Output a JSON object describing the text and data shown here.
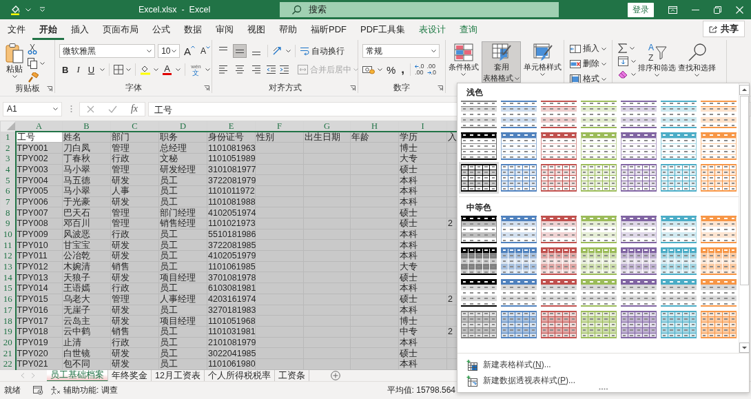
{
  "title_bar": {
    "title": "Excel.xlsx  -  Excel",
    "search_placeholder": "搜索",
    "sign_in": "登录"
  },
  "tabs": [
    {
      "label": "文件",
      "kind": "normal",
      "selected": false
    },
    {
      "label": "开始",
      "kind": "normal",
      "selected": true
    },
    {
      "label": "插入",
      "kind": "normal",
      "selected": false
    },
    {
      "label": "页面布局",
      "kind": "normal",
      "selected": false
    },
    {
      "label": "公式",
      "kind": "normal",
      "selected": false
    },
    {
      "label": "数据",
      "kind": "normal",
      "selected": false
    },
    {
      "label": "审阅",
      "kind": "normal",
      "selected": false
    },
    {
      "label": "视图",
      "kind": "normal",
      "selected": false
    },
    {
      "label": "帮助",
      "kind": "normal",
      "selected": false
    },
    {
      "label": "福昕PDF",
      "kind": "normal",
      "selected": false
    },
    {
      "label": "PDF工具集",
      "kind": "normal",
      "selected": false
    },
    {
      "label": "表设计",
      "kind": "contextual",
      "selected": false
    },
    {
      "label": "查询",
      "kind": "contextual",
      "selected": false
    }
  ],
  "share": "共享",
  "ribbon": {
    "clipboard": {
      "label": "剪贴板",
      "paste": "粘贴"
    },
    "font": {
      "label": "字体",
      "font_name": "微软雅黑",
      "font_size": "10",
      "grow": "A",
      "shrink": "A",
      "bold": "B",
      "italic": "I",
      "underline": "U",
      "font_color": "A",
      "phonetic": "wén",
      "phonetic_char": "文"
    },
    "alignment": {
      "label": "对齐方式",
      "vertical": [
        {
          "kind": "top",
          "selected": false
        },
        {
          "kind": "middle",
          "selected": true
        },
        {
          "kind": "bottom",
          "selected": false
        }
      ],
      "horizontal": [
        {
          "kind": "left",
          "selected": false
        },
        {
          "kind": "center",
          "selected": false
        },
        {
          "kind": "right",
          "selected": false
        }
      ],
      "wrap_text": "自动换行",
      "merge": {
        "label": "合并后居中",
        "disabled": true
      }
    },
    "number": {
      "label": "数字",
      "format": "常规",
      "percent": "%",
      "comma": ",",
      "increase_decimal": [
        ".0",
        ".00"
      ],
      "decrease_decimal": [
        ".00",
        ".0"
      ]
    },
    "styles": [
      {
        "kind": "conditional",
        "lines": [
          "条件格式"
        ],
        "selected": false
      },
      {
        "kind": "table",
        "lines": [
          "套用",
          "表格格式"
        ],
        "selected": true
      },
      {
        "kind": "cell",
        "lines": [
          "单元格样式"
        ],
        "selected": false
      }
    ],
    "cells": [
      {
        "kind": "insert",
        "label": "插入"
      },
      {
        "kind": "delete",
        "label": "删除"
      },
      {
        "kind": "format",
        "label": "格式"
      }
    ],
    "editing": [
      {
        "kind": "sort",
        "label": "排序和筛选",
        "icon_text": [
          "A",
          "Z"
        ]
      },
      {
        "kind": "find",
        "label": "查找和选择"
      }
    ]
  },
  "formula_bar": {
    "name_box": "A1",
    "fx": "fx",
    "value": "工号"
  },
  "sheet": {
    "columns": [
      {
        "label": "A",
        "selected": true
      },
      {
        "label": "B",
        "selected": true
      },
      {
        "label": "C",
        "selected": true
      },
      {
        "label": "D",
        "selected": true
      },
      {
        "label": "E",
        "selected": true
      },
      {
        "label": "F",
        "selected": true
      },
      {
        "label": "G",
        "selected": true
      },
      {
        "label": "H",
        "selected": true
      },
      {
        "label": "I",
        "selected": true
      },
      {
        "selected": true
      }
    ],
    "rows": [
      {
        "number": "1",
        "selected": true,
        "cells": [
          {
            "text": "工号",
            "active": true
          },
          "姓名",
          "部门",
          "职务",
          "身份证号",
          "性别",
          "出生日期",
          "年龄",
          "学历",
          "入"
        ]
      },
      {
        "number": "2",
        "selected": true,
        "cells": [
          "TPY001",
          "刀白凤",
          "管理",
          "总经理",
          "1101081963",
          null,
          null,
          null,
          "博士",
          null
        ]
      },
      {
        "number": "3",
        "selected": true,
        "cells": [
          "TPY002",
          "丁春秋",
          "行政",
          "文秘",
          "1101051989",
          null,
          null,
          null,
          "大专",
          null
        ]
      },
      {
        "number": "4",
        "selected": true,
        "cells": [
          "TPY003",
          "马小翠",
          "管理",
          "研发经理",
          "3101081977",
          null,
          null,
          null,
          "硕士",
          null
        ]
      },
      {
        "number": "5",
        "selected": true,
        "cells": [
          "TPY004",
          "马五德",
          "研发",
          "员工",
          "3722081979",
          null,
          null,
          null,
          "本科",
          null
        ]
      },
      {
        "number": "6",
        "selected": true,
        "cells": [
          "TPY005",
          "马小翠",
          "人事",
          "员工",
          "1101011972",
          null,
          null,
          null,
          "本科",
          null
        ]
      },
      {
        "number": "7",
        "selected": true,
        "cells": [
          "TPY006",
          "于光豪",
          "研发",
          "员工",
          "1101081988",
          null,
          null,
          null,
          "本科",
          null
        ]
      },
      {
        "number": "8",
        "selected": true,
        "cells": [
          "TPY007",
          "巴天石",
          "管理",
          "部门经理",
          "4102051974",
          null,
          null,
          null,
          "硕士",
          null
        ]
      },
      {
        "number": "9",
        "selected": true,
        "cells": [
          "TPY008",
          "邓百川",
          "管理",
          "销售经理",
          "1101021973",
          null,
          null,
          null,
          "硕士",
          "2"
        ]
      },
      {
        "number": "10",
        "selected": true,
        "cells": [
          "TPY009",
          "风波恶",
          "行政",
          "员工",
          "5510181986",
          null,
          null,
          null,
          "本科",
          null
        ]
      },
      {
        "number": "11",
        "selected": true,
        "cells": [
          "TPY010",
          "甘宝宝",
          "研发",
          "员工",
          "3722081985",
          null,
          null,
          null,
          "本科",
          null
        ]
      },
      {
        "number": "12",
        "selected": true,
        "cells": [
          "TPY011",
          "公冶乾",
          "研发",
          "员工",
          "4102051979",
          null,
          null,
          null,
          "本科",
          null
        ]
      },
      {
        "number": "13",
        "selected": true,
        "cells": [
          "TPY012",
          "木婉清",
          "销售",
          "员工",
          "1101061985",
          null,
          null,
          null,
          "大专",
          null
        ]
      },
      {
        "number": "14",
        "selected": true,
        "cells": [
          "TPY013",
          "天狼子",
          "研发",
          "项目经理",
          "3701081978",
          null,
          null,
          null,
          "硕士",
          null
        ]
      },
      {
        "number": "15",
        "selected": true,
        "cells": [
          "TPY014",
          "王语嫣",
          "行政",
          "员工",
          "6103081981",
          null,
          null,
          null,
          "本科",
          null
        ]
      },
      {
        "number": "16",
        "selected": true,
        "cells": [
          "TPY015",
          "乌老大",
          "管理",
          "人事经理",
          "4203161974",
          null,
          null,
          null,
          "硕士",
          "2"
        ]
      },
      {
        "number": "17",
        "selected": true,
        "cells": [
          "TPY016",
          "无崖子",
          "研发",
          "员工",
          "3270181983",
          null,
          null,
          null,
          "本科",
          null
        ]
      },
      {
        "number": "18",
        "selected": true,
        "cells": [
          "TPY017",
          "云岛主",
          "研发",
          "项目经理",
          "1101051968",
          null,
          null,
          null,
          "博士",
          null
        ]
      },
      {
        "number": "19",
        "selected": true,
        "cells": [
          "TPY018",
          "云中鹤",
          "销售",
          "员工",
          "1101031981",
          null,
          null,
          null,
          "中专",
          "2"
        ]
      },
      {
        "number": "20",
        "selected": true,
        "cells": [
          "TPY019",
          "止清",
          "行政",
          "员工",
          "2101081979",
          null,
          null,
          null,
          "本科",
          null
        ]
      },
      {
        "number": "21",
        "selected": true,
        "cells": [
          "TPY020",
          "白世镜",
          "研发",
          "员工",
          "3022041985",
          null,
          null,
          null,
          "硕士",
          null
        ]
      },
      {
        "number": "22",
        "selected": true,
        "cells": [
          "TPY021",
          "包不同",
          "研发",
          "员工",
          "1101061980",
          null,
          null,
          null,
          "本科",
          null
        ]
      }
    ]
  },
  "sheet_tabs": [
    {
      "label": "员工基础档案",
      "selected": true
    },
    {
      "label": "年终奖金",
      "selected": false
    },
    {
      "label": "12月工资表",
      "selected": false
    },
    {
      "label": "个人所得税税率",
      "selected": false
    },
    {
      "label": "工资条",
      "selected": false
    }
  ],
  "status_bar": {
    "ready": "就绪",
    "accessibility": "辅助功能: 调查",
    "average": "平均值: 15798.564"
  },
  "table_styles_menu": {
    "sections": [
      {
        "title": "浅色",
        "rows": [
          {
            "kind": "light-banded",
            "styles": [
              {
                "color": "#808080",
                "selected": false
              },
              {
                "color": "#4f81bd",
                "selected": false
              },
              {
                "color": "#c0504d",
                "selected": false
              },
              {
                "color": "#9bbb59",
                "selected": false
              },
              {
                "color": "#8064a2",
                "selected": false
              },
              {
                "color": "#4bacc6",
                "selected": false
              },
              {
                "color": "#f79646",
                "selected": false
              }
            ]
          },
          {
            "kind": "light-header",
            "styles": [
              {
                "color": "#000000",
                "selected": false
              },
              {
                "color": "#4f81bd",
                "selected": false
              },
              {
                "color": "#c0504d",
                "selected": false
              },
              {
                "color": "#9bbb59",
                "selected": false
              },
              {
                "color": "#8064a2",
                "selected": false
              },
              {
                "color": "#4bacc6",
                "selected": false
              },
              {
                "color": "#f79646",
                "selected": false
              }
            ]
          },
          {
            "kind": "light-grid",
            "styles": [
              {
                "color": "#000000",
                "selected": true
              },
              {
                "color": "#4f81bd",
                "selected": false
              },
              {
                "color": "#c0504d",
                "selected": false
              },
              {
                "color": "#9bbb59",
                "selected": false
              },
              {
                "color": "#8064a2",
                "selected": false
              },
              {
                "color": "#4bacc6",
                "selected": false
              },
              {
                "color": "#f79646",
                "selected": false
              }
            ]
          }
        ]
      },
      {
        "title": "中等色",
        "rows": [
          {
            "kind": "medium-banded",
            "styles": [
              {
                "color": "#000000",
                "selected": false
              },
              {
                "color": "#4f81bd",
                "selected": false
              },
              {
                "color": "#c0504d",
                "selected": false
              },
              {
                "color": "#9bbb59",
                "selected": false
              },
              {
                "color": "#8064a2",
                "selected": false
              },
              {
                "color": "#4bacc6",
                "selected": false
              },
              {
                "color": "#f79646",
                "selected": false
              }
            ]
          },
          {
            "kind": "medium-grid",
            "styles": [
              {
                "color": "#000000",
                "selected": false
              },
              {
                "color": "#4f81bd",
                "selected": false
              },
              {
                "color": "#c0504d",
                "selected": false
              },
              {
                "color": "#9bbb59",
                "selected": false
              },
              {
                "color": "#8064a2",
                "selected": false
              },
              {
                "color": "#4bacc6",
                "selected": false
              },
              {
                "color": "#f79646",
                "selected": false
              }
            ]
          },
          {
            "kind": "medium-lines",
            "styles": [
              {
                "color": "#000000",
                "selected": false
              },
              {
                "color": "#4f81bd",
                "selected": false
              },
              {
                "color": "#c0504d",
                "selected": false
              },
              {
                "color": "#9bbb59",
                "selected": false
              },
              {
                "color": "#8064a2",
                "selected": false
              },
              {
                "color": "#4bacc6",
                "selected": false
              },
              {
                "color": "#f79646",
                "selected": false
              }
            ]
          },
          {
            "kind": "medium-tint-grid",
            "styles": [
              {
                "color": "#7f7f7f",
                "selected": false
              },
              {
                "color": "#4f81bd",
                "selected": false
              },
              {
                "color": "#c0504d",
                "selected": false
              },
              {
                "color": "#9bbb59",
                "selected": false
              },
              {
                "color": "#8064a2",
                "selected": false
              },
              {
                "color": "#4bacc6",
                "selected": false
              },
              {
                "color": "#f79646",
                "selected": false
              }
            ]
          }
        ]
      }
    ],
    "commands": [
      {
        "kind": "new-table-style",
        "before": "新建表格样式(",
        "key": "N",
        "after": ")..."
      },
      {
        "kind": "new-pivot-style",
        "before": "新建数据透视表样式(",
        "key": "P",
        "after": ")..."
      }
    ]
  }
}
